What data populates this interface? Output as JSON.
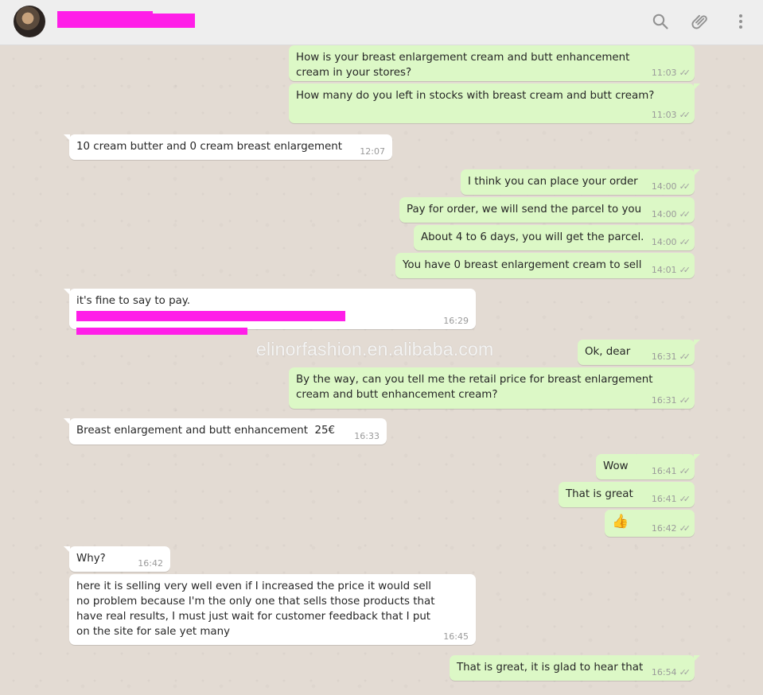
{
  "header": {
    "contact_name": "",
    "icons": [
      "search-icon",
      "attach-icon",
      "menu-icon"
    ]
  },
  "watermark": "elinorfashion.en.alibaba.com",
  "messages": [
    {
      "dir": "out",
      "text": "How is your breast enlargement cream and butt enhancement cream in your stores?",
      "time": "11:03",
      "ticks": "✓✓"
    },
    {
      "dir": "out",
      "text": "How many do you left in stocks with breast cream and butt cream?",
      "time": "11:03",
      "ticks": "✓✓"
    },
    {
      "dir": "in",
      "text": "10 cream butter and 0 cream breast enlargement",
      "time": "12:07"
    },
    {
      "dir": "out",
      "text": "I think you can place your order",
      "time": "14:00",
      "ticks": "✓✓"
    },
    {
      "dir": "out",
      "text": "Pay for order, we will send the parcel to you",
      "time": "14:00",
      "ticks": "✓✓"
    },
    {
      "dir": "out",
      "text": "About 4 to 6 days, you will get the parcel.",
      "time": "14:00",
      "ticks": "✓✓"
    },
    {
      "dir": "out",
      "text": "You have 0 breast enlargement cream to sell",
      "time": "14:01",
      "ticks": "✓✓"
    },
    {
      "dir": "in",
      "text": "it's fine to say to pay.",
      "time": "16:29"
    },
    {
      "dir": "out",
      "text": "Ok, dear",
      "time": "16:31",
      "ticks": "✓✓"
    },
    {
      "dir": "out",
      "text": "By the way, can you tell me the retail price for breast enlargement cream and butt enhancement cream?",
      "time": "16:31",
      "ticks": "✓✓"
    },
    {
      "dir": "in",
      "text": "Breast enlargement and butt enhancement  25€",
      "time": "16:33"
    },
    {
      "dir": "out",
      "text": "Wow",
      "time": "16:41",
      "ticks": "✓✓"
    },
    {
      "dir": "out",
      "text": "That is great",
      "time": "16:41",
      "ticks": "✓✓"
    },
    {
      "dir": "out",
      "text": "👍",
      "time": "16:42",
      "ticks": "✓✓"
    },
    {
      "dir": "in",
      "text": "Why?",
      "time": "16:42"
    },
    {
      "dir": "in",
      "text": "here it is selling very well even if I increased the price it would sell no problem because I'm the only one that sells those products that have real results, I must just wait for customer feedback that I put on the site for sale yet many",
      "time": "16:45"
    },
    {
      "dir": "out",
      "text": "That is great, it is glad to hear that",
      "time": "16:54",
      "ticks": "✓✓"
    }
  ],
  "colors": {
    "outgoing_bubble": "#dcf8c6",
    "incoming_bubble": "#ffffff",
    "chat_background": "#e5ddd5",
    "redaction": "#ff1ee8",
    "header": "#eeeeee"
  }
}
